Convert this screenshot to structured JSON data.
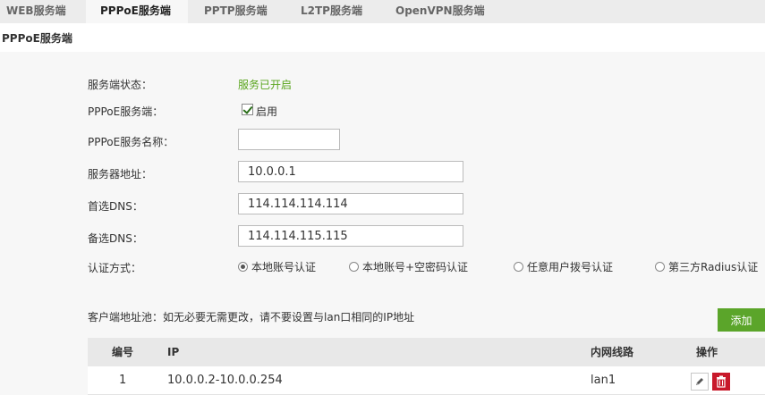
{
  "tabs": [
    {
      "label": "WEB服务端"
    },
    {
      "label": "PPPoE服务端"
    },
    {
      "label": "PPTP服务端"
    },
    {
      "label": "L2TP服务端"
    },
    {
      "label": "OpenVPN服务端"
    }
  ],
  "section_title": "PPPoE服务端",
  "form": {
    "status_label": "服务端状态：",
    "status_value": "服务已开启",
    "enable_label": "PPPoE服务端：",
    "enable_checkbox_label": "启用",
    "name_label": "PPPoE服务名称：",
    "name_value": "",
    "server_label": "服务器地址：",
    "server_value": "10.0.0.1",
    "dns1_label": "首选DNS：",
    "dns1_value": "114.114.114.114",
    "dns2_label": "备选DNS：",
    "dns2_value": "114.114.115.115",
    "auth_label": "认证方式：",
    "auth_options": [
      {
        "label": "本地账号认证",
        "checked": true
      },
      {
        "label": "本地账号+空密码认证",
        "checked": false
      },
      {
        "label": "任意用户拨号认证",
        "checked": false
      },
      {
        "label": "第三方Radius认证",
        "checked": false
      }
    ]
  },
  "pool": {
    "note": "客户端地址池：如无必要无需更改，请不要设置与lan口相同的IP地址",
    "add_label": "添加",
    "columns": [
      "编号",
      "IP",
      "内网线路",
      "操作"
    ],
    "rows": [
      {
        "id": "1",
        "ip": "10.0.0.2-10.0.0.254",
        "line": "lan1"
      }
    ]
  },
  "colors": {
    "status_green": "#5aa51f",
    "add_button": "#5ba52a",
    "delete_button": "#c8192b"
  }
}
